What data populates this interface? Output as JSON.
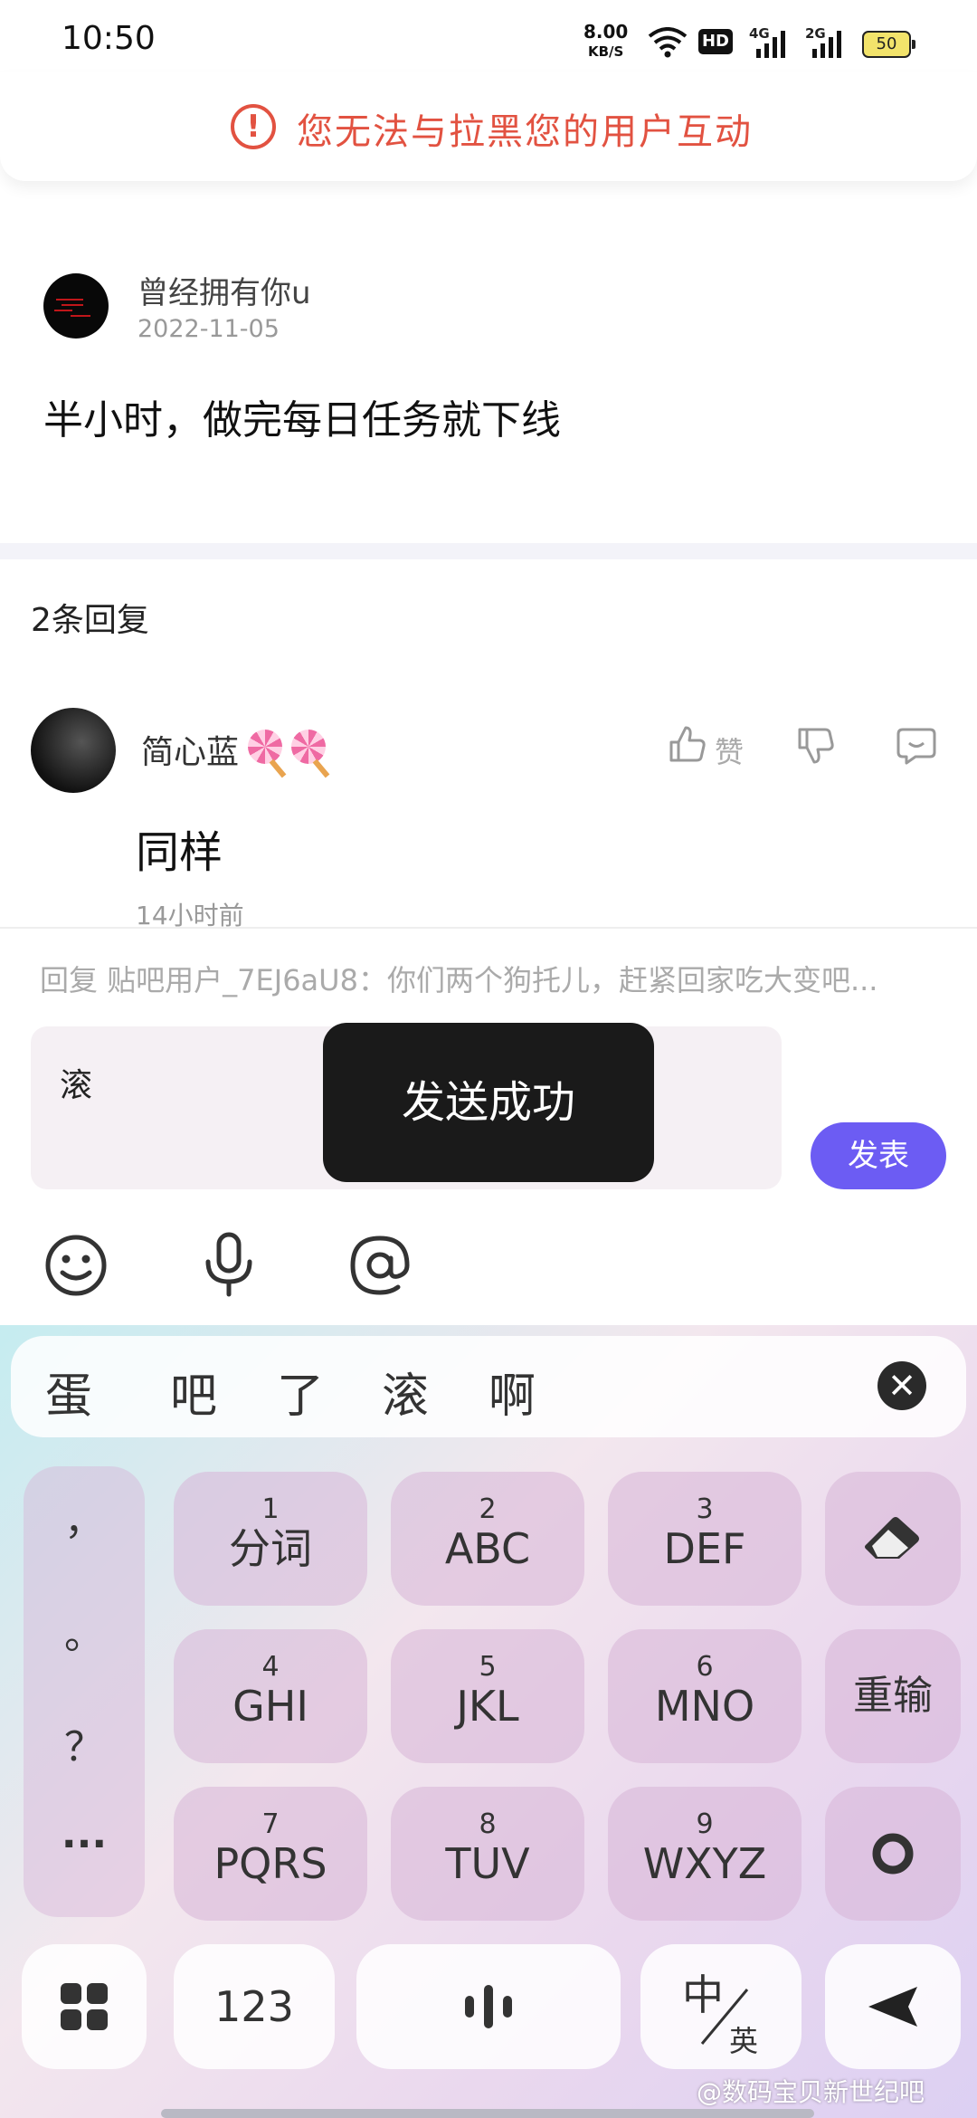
{
  "status_bar": {
    "time": "10:50",
    "net_speed": "8.00",
    "net_speed_unit": "KB/S",
    "hd": "HD",
    "sim1": "4G",
    "sim2": "2G",
    "battery": "50"
  },
  "warning": {
    "text": "您无法与拉黑您的用户互动",
    "icon": "warning-circle-icon"
  },
  "post": {
    "author": "曾经拥有你u",
    "date": "2022-11-05",
    "content": "半小时，做完每日任务就下线"
  },
  "replies": {
    "count_label": "2条回复",
    "items": [
      {
        "author": "简心蓝",
        "content": "同样",
        "time": "14小时前",
        "like_label": "赞"
      }
    ]
  },
  "composer": {
    "reply_hint": "回复 贴吧用户_7EJ6aU8：你们两个狗托儿，赶紧回家吃大变吧...",
    "input_value": "滚",
    "publish_label": "发表",
    "toast": "发送成功"
  },
  "keyboard": {
    "candidates": [
      "蛋",
      "吧",
      "了",
      "滚",
      "啊"
    ],
    "punctuation": [
      "，",
      "。",
      "？",
      "···"
    ],
    "keys": [
      {
        "num": "1",
        "label": "分词"
      },
      {
        "num": "2",
        "label": "ABC"
      },
      {
        "num": "3",
        "label": "DEF"
      },
      {
        "num": "4",
        "label": "GHI"
      },
      {
        "num": "5",
        "label": "JKL"
      },
      {
        "num": "6",
        "label": "MNO"
      },
      {
        "num": "7",
        "label": "PQRS"
      },
      {
        "num": "8",
        "label": "TUV"
      },
      {
        "num": "9",
        "label": "WXYZ"
      }
    ],
    "reenter_label": "重输",
    "numbers_label": "123",
    "lang_zh": "中",
    "lang_en": "英"
  },
  "watermark": "@数码宝贝新世纪吧",
  "colors": {
    "warning": "#e25241",
    "accent": "#6c5cf3",
    "toast_bg": "#1a1a1a"
  }
}
